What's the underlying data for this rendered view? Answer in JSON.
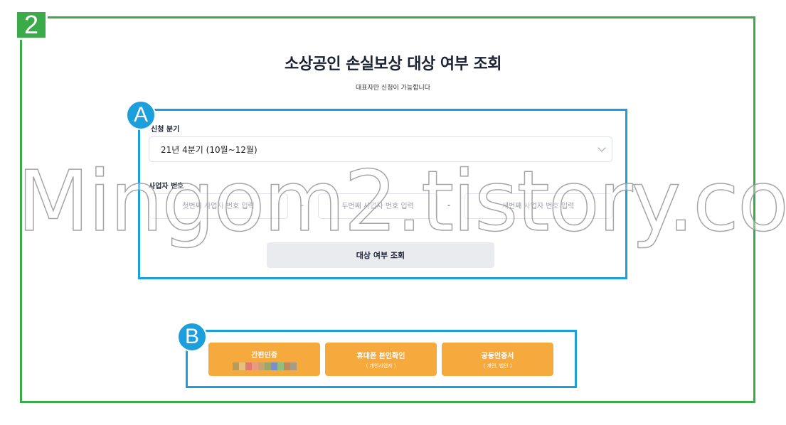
{
  "annotations": {
    "step_number": "2",
    "section_a": "A",
    "section_b": "B",
    "frame_color": "#3bab4a",
    "box_color": "#1ba0dd"
  },
  "page": {
    "title": "소상공인 손실보상 대상 여부 조회",
    "subtitle": "대표자만 신청이 가능합니다"
  },
  "form": {
    "quarter_label": "신청 분기",
    "quarter_selected": "21년 4분기 (10월~12월)",
    "business_number_label": "사업자 번호",
    "business_number_placeholders": [
      "첫번째 사업자 번호 입력",
      "두번째 사업자 번호 입력",
      "세번째 사업자 번호 입력"
    ],
    "separator": "-",
    "query_button": "대상 여부 조회"
  },
  "auth": {
    "accent_color": "#f6a93c",
    "buttons": [
      {
        "label": "간편인증",
        "sub": ""
      },
      {
        "label": "휴대폰 본인확인",
        "sub": "( 개인사업자 )"
      },
      {
        "label": "공동인증서",
        "sub": "( 개인, 법인 )"
      }
    ],
    "provider_icon_colors": [
      "#b89a5a",
      "#e8c07a",
      "#e07b72",
      "#ec9a7f",
      "#c7a36e",
      "#9ea56b",
      "#7b8fd0",
      "#8fc07b",
      "#c08a5b",
      "#a99a86"
    ]
  },
  "watermark": "Mingom2.tistory.com"
}
